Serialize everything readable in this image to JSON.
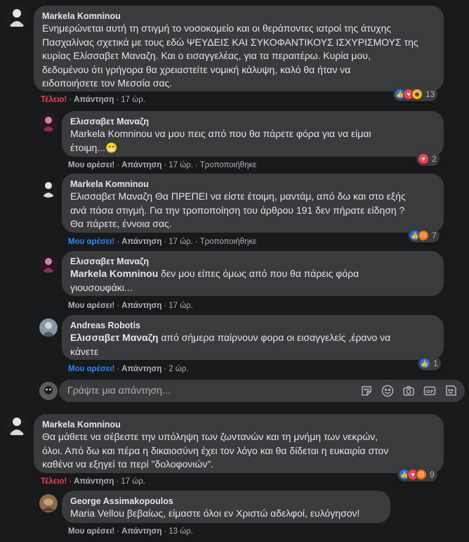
{
  "comments": [
    {
      "author": "Markela Komninou",
      "lines": [
        "Ενημερώνεται αυτή τη στιγμή το νοσοκομείο και οι θεράποντες ιατροί της άτυχης",
        "Πασχαλίνας σχετικά με τους εδώ ΨΕΥΔΕΙΣ ΚΑΙ ΣΥΚΟΦΑΝΤΙΚΟΥΣ ΙΣΧΥΡΙΣΜΟΥΣ της",
        "κυρίας Ελίσσαβετ Μαναζη. Και ο εισαγγελέας, για τα περαιτέρω. Κυρία μου,",
        "δεδομένου ότι γρήγορα θα χρειαστείτε νομική κάλυψη, καλό θα ήταν να",
        "ειδοποιήσετε τον Μεσσία σας."
      ],
      "like_label": "Τέλειο!",
      "reply_label": "Απάντηση",
      "time": "17 ώρ.",
      "reaction_count": "13"
    },
    {
      "author": "Ελισσαβετ Μαναζη",
      "lines": [
        "Markela Komninou να μου πεις από που θα πάρετε φόρα για να είμαι",
        "έτοιμη...😁"
      ],
      "like_label": "Μου αρέσει!",
      "reply_label": "Απάντηση",
      "time": "17 ώρ.",
      "edited": "Τροποποιήθηκε",
      "reaction_count": "2"
    },
    {
      "author": "Markela Komninou",
      "lines": [
        "Ελισσαβετ Μαναζη Θα ΠΡΕΠΕΙ να είστε έτοιμη, μαντάμ, από δω και στο εξής",
        "ανά πάσα στιγμή. Για την τροποποίηση του άρθρου 191 δεν πήρατε είδηση ?",
        "Θα πάρετε, έννοια σας."
      ],
      "like_label": "Μου αρέσει!",
      "reply_label": "Απάντηση",
      "time": "17 ώρ.",
      "edited": "Τροποποιήθηκε",
      "reaction_count": "7"
    },
    {
      "author": "Ελισσαβετ Μαναζη",
      "mention": "Markela Komninou",
      "line1_rest": " δεν μου είπες όμως από που θα πάρεις φόρα",
      "line2": "γιουσουφάκι...",
      "like_label": "Μου αρέσει!",
      "reply_label": "Απάντηση",
      "time": "17 ώρ."
    },
    {
      "author": "Andreas Robotis",
      "mention": "Ελισσαβετ Μαναζη",
      "line1_rest": " από σήμερα παίρνουν φορα οι εισαγγελείς ,έρανο να",
      "line2": "κάνετε",
      "like_label": "Μου αρέσει!",
      "reply_label": "Απάντηση",
      "time": "2 ώρ.",
      "reaction_count": "1"
    },
    {
      "author": "Markela Komninou",
      "lines": [
        "Θα μάθετε να σέβεστε την υπόληψη των ζωντανών και τη μνήμη των νεκρών,",
        "όλοι. Από δω και πέρα η δικαιοσύνη έχει τον λόγο και θα δίδεται η ευκαιρία στον",
        "καθένα να εξηγεί τα περί \"δολοφονιών\"."
      ],
      "like_label": "Τέλειο!",
      "reply_label": "Απάντηση",
      "time": "17 ώρ.",
      "reaction_count": "9"
    },
    {
      "author": "George Assimakopoulos",
      "lines": [
        "Maria Vellou βεβαίως, είμαστε όλοι εν Χριστώ αδελφοί, ευλόγησον!"
      ],
      "like_label": "Μου αρέσει!",
      "reply_label": "Απάντηση",
      "time": "13 ώρ."
    }
  ],
  "reply_box": {
    "placeholder": "Γράψτε μια απάντηση..."
  },
  "icons": [
    "sticker-icon",
    "emoji-icon",
    "camera-icon",
    "gif-icon",
    "sticker-alt-icon"
  ],
  "colors": {
    "background": "#18191a",
    "bubble": "#3a3b3c",
    "text": "#e4e6eb",
    "secondary": "#b0b3b8",
    "love_red": "#f3425f",
    "like_blue": "#2d88ff"
  },
  "dot": "·"
}
